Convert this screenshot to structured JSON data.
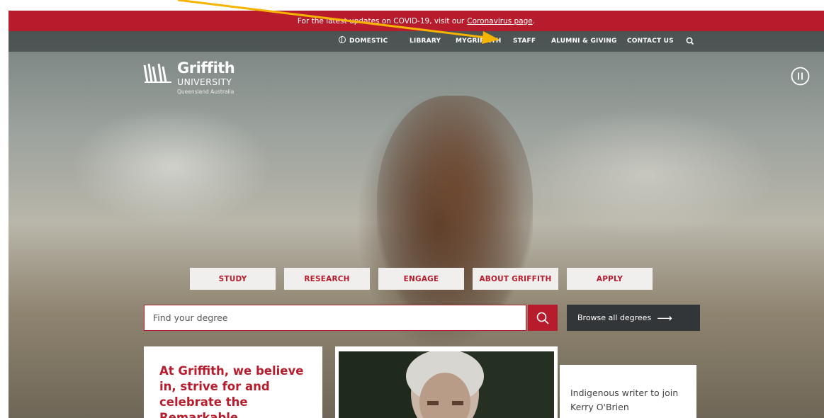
{
  "covid_banner": {
    "text": "For the latest updates on COVID-19, visit our",
    "link": "Coronavirus page",
    "suffix": "."
  },
  "top_nav": {
    "domestic": "DOMESTIC",
    "library": "LIBRARY",
    "mygriffith": "MYGRIFFITH",
    "staff": "STAFF",
    "alumni": "ALUMNI & GIVING",
    "contact": "CONTACT US"
  },
  "logo": {
    "name": "Griffith",
    "sub": "UNIVERSITY",
    "location": "Queensland Australia"
  },
  "main_menu": [
    "STUDY",
    "RESEARCH",
    "ENGAGE",
    "ABOUT GRIFFITH",
    "APPLY"
  ],
  "search": {
    "placeholder": "Find your degree",
    "browse_label": "Browse all degrees",
    "browse_arrow": "⟶"
  },
  "cards": {
    "tagline": "At Griffith, we believe in, strive for and celebrate the Remarkable.",
    "news_title": "Indigenous writer to join Kerry O'Brien"
  },
  "colors": {
    "brand_red": "#b71c2c",
    "nav_dark": "#333639",
    "annotation_arrow": "#f5b400"
  },
  "icons": {
    "globe": "globe-icon",
    "search": "search-icon",
    "pause": "pause-icon"
  }
}
